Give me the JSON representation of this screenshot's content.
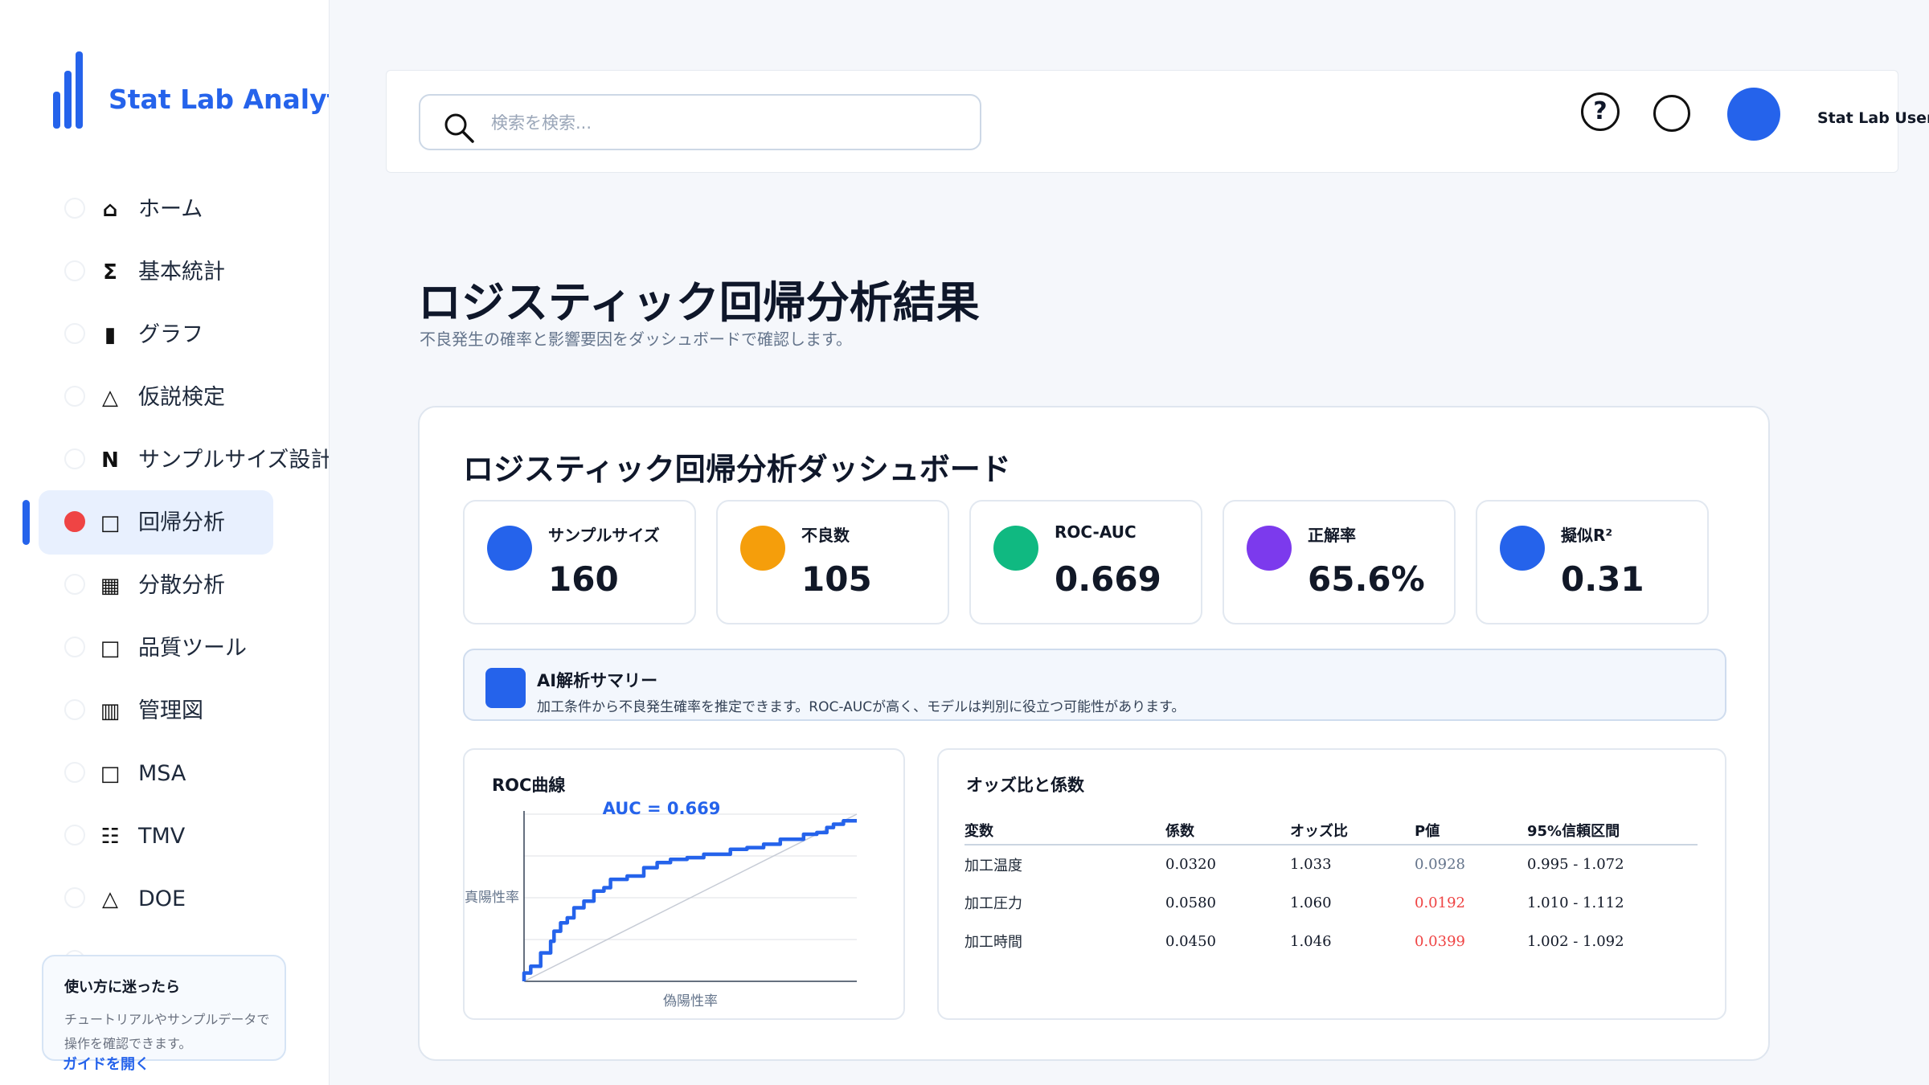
{
  "app": {
    "name": "Stat Lab Analytics"
  },
  "sidebar": {
    "items": [
      {
        "icon": "home-icon",
        "glyph": "⌂",
        "label": "ホーム",
        "active": false
      },
      {
        "icon": "sigma-icon",
        "glyph": "Σ",
        "label": "基本統計",
        "active": false
      },
      {
        "icon": "bar-icon",
        "glyph": "▮",
        "label": "グラフ",
        "active": false
      },
      {
        "icon": "triangle-icon",
        "glyph": "△",
        "label": "仮説検定",
        "active": false
      },
      {
        "icon": "n-icon",
        "glyph": "N",
        "label": "サンプルサイズ設計",
        "active": false
      },
      {
        "icon": "square-icon",
        "glyph": "□",
        "label": "回帰分析",
        "active": true
      },
      {
        "icon": "grid-icon",
        "glyph": "▦",
        "label": "分散分析",
        "active": false
      },
      {
        "icon": "square-icon",
        "glyph": "□",
        "label": "品質ツール",
        "active": false
      },
      {
        "icon": "columns-icon",
        "glyph": "▥",
        "label": "管理図",
        "active": false
      },
      {
        "icon": "square-icon",
        "glyph": "□",
        "label": "MSA",
        "active": false
      },
      {
        "icon": "list-icon",
        "glyph": "☷",
        "label": "TMV",
        "active": false
      },
      {
        "icon": "triangle-icon",
        "glyph": "△",
        "label": "DOE",
        "active": false
      }
    ],
    "help": {
      "title": "使い方に迷ったら",
      "text": "チュートリアルやサンプルデータで操作を確認できます。",
      "link": "ガイドを開く"
    }
  },
  "topbar": {
    "search_placeholder": "検索を検索...",
    "help_glyph": "?",
    "user_name": "Stat Lab User"
  },
  "page": {
    "title": "ロジスティック回帰分析結果",
    "subtitle": "不良発生の確率と影響要因をダッシュボードで確認します。"
  },
  "dashboard": {
    "title": "ロジスティック回帰分析ダッシュボード",
    "kpis": [
      {
        "label": "サンプルサイズ",
        "value": "160",
        "color": "#2563eb"
      },
      {
        "label": "不良数",
        "value": "105",
        "color": "#f59e0b"
      },
      {
        "label": "ROC-AUC",
        "value": "0.669",
        "color": "#10b981"
      },
      {
        "label": "正解率",
        "value": "65.6%",
        "color": "#7c3aed"
      },
      {
        "label": "擬似R²",
        "value": "0.31",
        "color": "#2563eb"
      }
    ],
    "ai": {
      "title": "AI解析サマリー",
      "text": "加工条件から不良発生確率を推定できます。ROC-AUCが高く、モデルは判別に役立つ可能性があります。"
    },
    "roc": {
      "title": "ROC曲線",
      "auc_label": "AUC = 0.669",
      "xlabel": "偽陽性率",
      "ylabel": "真陽性率"
    },
    "odds": {
      "title": "オッズ比と係数",
      "headers": [
        "変数",
        "係数",
        "オッズ比",
        "P値",
        "95%信頼区間"
      ],
      "rows": [
        {
          "var": "加工温度",
          "coef": "0.0320",
          "or": "1.033",
          "p": "0.0928",
          "ci": "0.995 - 1.072",
          "significant": false
        },
        {
          "var": "加工圧力",
          "coef": "0.0580",
          "or": "1.060",
          "p": "0.0192",
          "ci": "1.010 - 1.112",
          "significant": true
        },
        {
          "var": "加工時間",
          "coef": "0.0450",
          "or": "1.046",
          "p": "0.0399",
          "ci": "1.002 - 1.092",
          "significant": true
        }
      ],
      "colors": {
        "significant": "#ef4444",
        "not_significant": "#64748b"
      }
    }
  },
  "chart_data": {
    "type": "line",
    "title": "ROC曲線",
    "xlabel": "偽陽性率",
    "ylabel": "真陽性率",
    "xlim": [
      0,
      1
    ],
    "ylim": [
      0,
      1
    ],
    "annotation": "AUC = 0.669",
    "series": [
      {
        "x": [
          0.0,
          0.0,
          0.02,
          0.02,
          0.05,
          0.05,
          0.08,
          0.08,
          0.09,
          0.09,
          0.11,
          0.11,
          0.13,
          0.13,
          0.15,
          0.15,
          0.18,
          0.18,
          0.21,
          0.21,
          0.24,
          0.24,
          0.26,
          0.26,
          0.31,
          0.31,
          0.36,
          0.36,
          0.4,
          0.4,
          0.44,
          0.44,
          0.49,
          0.49,
          0.54,
          0.54,
          0.62,
          0.62,
          0.67,
          0.67,
          0.72,
          0.72,
          0.77,
          0.77,
          0.84,
          0.84,
          0.88,
          0.88,
          0.91,
          0.91,
          0.93,
          0.93,
          0.96,
          0.96,
          1.0
        ],
        "y": [
          0.0,
          0.05,
          0.05,
          0.09,
          0.09,
          0.17,
          0.17,
          0.24,
          0.24,
          0.3,
          0.3,
          0.35,
          0.35,
          0.38,
          0.38,
          0.44,
          0.44,
          0.48,
          0.48,
          0.54,
          0.54,
          0.56,
          0.56,
          0.61,
          0.61,
          0.63,
          0.63,
          0.68,
          0.68,
          0.71,
          0.71,
          0.73,
          0.73,
          0.74,
          0.74,
          0.76,
          0.76,
          0.79,
          0.79,
          0.8,
          0.8,
          0.82,
          0.82,
          0.85,
          0.85,
          0.88,
          0.88,
          0.89,
          0.89,
          0.92,
          0.92,
          0.94,
          0.94,
          0.96,
          0.96
        ]
      }
    ],
    "reference_line": {
      "x": [
        0,
        1
      ],
      "y": [
        0,
        1
      ]
    },
    "grid": true
  }
}
